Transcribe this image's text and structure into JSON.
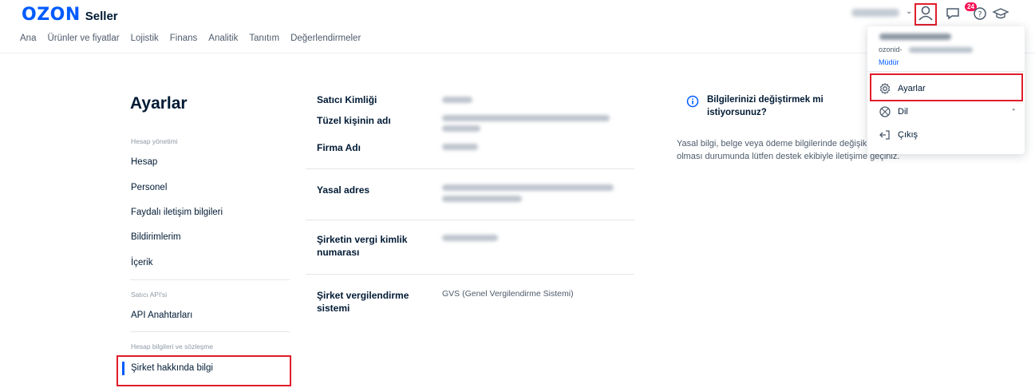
{
  "header": {
    "logo_brand": "OZON",
    "logo_product": "Seller",
    "notification_badge": "24"
  },
  "nav": [
    "Ana",
    "Ürünler ve fiyatlar",
    "Lojistik",
    "Finans",
    "Analitik",
    "Tanıtım",
    "Değerlendirmeler"
  ],
  "sidebar": {
    "title": "Ayarlar",
    "sections": [
      {
        "label": "Hesap yönetimi",
        "items": [
          "Hesap",
          "Personel",
          "Faydalı iletişim bilgileri",
          "Bildirimlerim",
          "İçerik"
        ]
      },
      {
        "label": "Satıcı API'si",
        "items": [
          "API Anahtarları"
        ]
      },
      {
        "label": "Hesap bilgileri ve sözleşme",
        "items": [
          "Şirket hakkında bilgi"
        ]
      }
    ]
  },
  "fields": [
    {
      "label": "Satıcı Kimliği"
    },
    {
      "label": "Tüzel kişinin adı"
    },
    {
      "label": "Firma Adı"
    },
    {
      "label": "Yasal adres"
    },
    {
      "label": "Şirketin vergi kimlik numarası"
    },
    {
      "label": "Şirket vergilendirme sistemi",
      "value": "GVS (Genel Vergilendirme Sistemi)"
    }
  ],
  "info": {
    "title": "Bilgilerinizi değiştirmek mi istiyorsunuz?",
    "text": "Yasal bilgi, belge veya ödeme bilgilerinde değişiklik olması durumunda lütfen destek ekibiyle iletişime geçiniz."
  },
  "dropdown": {
    "ozonid_prefix": "ozonid-",
    "role": "Müdür",
    "items": [
      "Ayarlar",
      "Dil",
      "Çıkış"
    ]
  },
  "colors": {
    "accent": "#005bff",
    "highlight": "#e11d2a",
    "badge": "#f91155"
  }
}
